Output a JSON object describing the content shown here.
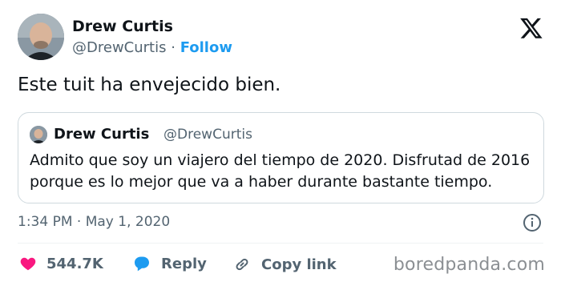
{
  "author": {
    "name": "Drew Curtis",
    "handle": "@DrewCurtis",
    "separator": "·",
    "follow_label": "Follow",
    "avatar_icon": "avatar-photo"
  },
  "brand_icon": "x-logo-icon",
  "tweet": {
    "text": "Este tuit ha envejecido bien."
  },
  "quoted_tweet": {
    "name": "Drew Curtis",
    "handle": "@DrewCurtis",
    "text": "Admito que soy un viajero del tiempo de 2020. Disfrutad de 2016 porque es lo mejor que va a haber durante bastante tiempo."
  },
  "meta": {
    "timestamp": "1:34 PM · May 1, 2020",
    "info_icon": "info-icon"
  },
  "actions": {
    "likes_count": "544.7K",
    "reply_label": "Reply",
    "copy_link_label": "Copy link"
  },
  "watermark": "boredpanda.com",
  "colors": {
    "accent": "#1d9bf0",
    "like": "#f91880",
    "muted": "#536471",
    "text": "#0f1419"
  }
}
